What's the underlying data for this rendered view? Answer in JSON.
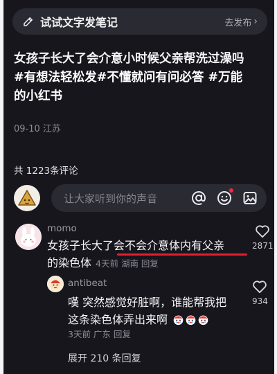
{
  "topbar": {
    "title": "试试文字发笔记",
    "action": "去发布",
    "action_chevron": "›"
  },
  "post": {
    "line1": "女孩子长大了会介意小时候父亲帮洗过澡吗",
    "line2": "#有想法轻松发#不懂就问有问必答 #万能",
    "line3": "的小红书",
    "date": "09-10 江苏"
  },
  "comments_header": {
    "count_text": "共 1223条评论"
  },
  "input": {
    "placeholder": "让大家听到你的声音",
    "icons": [
      "at-icon",
      "emoji-icon",
      "image-icon"
    ]
  },
  "comment1": {
    "user": "momo",
    "text_line1": "女孩子长大了会不会介意体内有父亲",
    "text_line2": "的染色体",
    "meta": "4天前 湖南 回复",
    "likes": "2871"
  },
  "comment2": {
    "user": "antibeat",
    "text_line1": "嘆 突然感觉好脏啊，谁能帮我把",
    "text_line2": "这条染色体弄出来啊",
    "meta": "3天前 广东 回复",
    "likes": "934",
    "emoji": "crying-face-icon"
  },
  "replies": {
    "expand_text": "展开 210 条回复"
  },
  "colors": {
    "background": "#17161d",
    "surface": "#2a2a33",
    "accent_red": "#e3202e"
  }
}
